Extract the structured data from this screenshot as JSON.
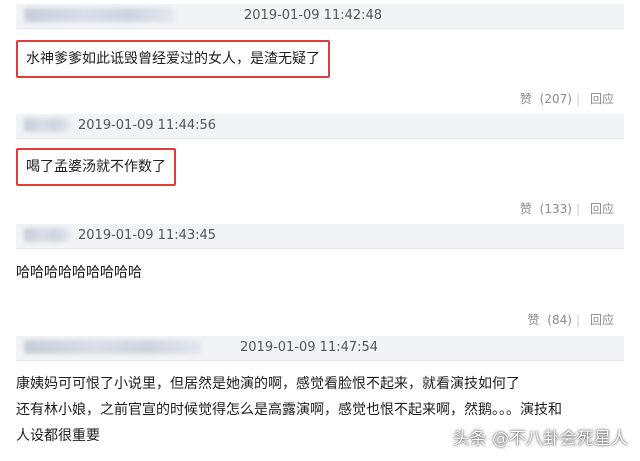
{
  "comments": [
    {
      "timestamp": "2019-01-09 11:42:48",
      "text": "水神爹爹如此诋毁曾经爱过的女人，是渣无疑了",
      "like_label": "赞",
      "like_count": "(207)",
      "reply_label": "回应"
    },
    {
      "timestamp": "2019-01-09 11:44:56",
      "text": "喝了孟婆汤就不作数了",
      "like_label": "赞",
      "like_count": "(133)",
      "reply_label": "回应"
    },
    {
      "timestamp": "2019-01-09 11:43:45",
      "text": "哈哈哈哈哈哈哈哈哈",
      "like_label": "赞",
      "like_count": "(84)",
      "reply_label": "回应"
    },
    {
      "timestamp": "2019-01-09 11:47:54",
      "lines": [
        "康姨妈可可恨了小说里，但居然是她演的啊，感觉看脸恨不起来，就看演技如何了",
        "还有林小娘，之前官宣的时候觉得怎么是高露演啊，感觉也恨不起来啊，然鹅。。。演技和",
        "人设都很重要"
      ]
    }
  ],
  "watermark": "头条 @不八卦会死星人",
  "colors": {
    "highlight": "#e23b3b",
    "meta_bg": "#f2f3f6"
  }
}
